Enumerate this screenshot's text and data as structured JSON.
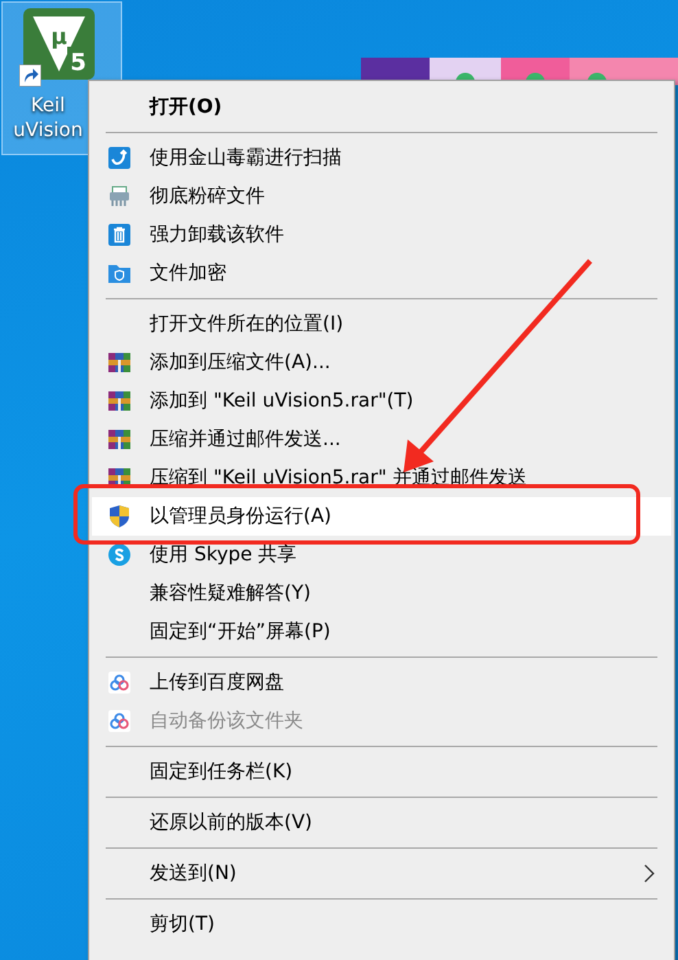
{
  "desktop_icon": {
    "label": "Keil uVision",
    "logo_marks": [
      "μ",
      "5"
    ]
  },
  "context_menu": {
    "items": [
      {
        "kind": "item",
        "label": "打开(O)",
        "default": true,
        "selected": false,
        "disabled": false,
        "submenu": false
      },
      {
        "kind": "separator"
      },
      {
        "kind": "item",
        "label": "使用金山毒霸进行扫描",
        "default": false,
        "selected": false,
        "disabled": false,
        "submenu": false
      },
      {
        "kind": "item",
        "label": "彻底粉碎文件",
        "default": false,
        "selected": false,
        "disabled": false,
        "submenu": false
      },
      {
        "kind": "item",
        "label": "强力卸载该软件",
        "default": false,
        "selected": false,
        "disabled": false,
        "submenu": false
      },
      {
        "kind": "item",
        "label": "文件加密",
        "default": false,
        "selected": false,
        "disabled": false,
        "submenu": false
      },
      {
        "kind": "separator"
      },
      {
        "kind": "item",
        "label": "打开文件所在的位置(I)",
        "default": false,
        "selected": false,
        "disabled": false,
        "submenu": false
      },
      {
        "kind": "item",
        "label": "添加到压缩文件(A)...",
        "default": false,
        "selected": false,
        "disabled": false,
        "submenu": false
      },
      {
        "kind": "item",
        "label": "添加到 \"Keil uVision5.rar\"(T)",
        "default": false,
        "selected": false,
        "disabled": false,
        "submenu": false
      },
      {
        "kind": "item",
        "label": "压缩并通过邮件发送...",
        "default": false,
        "selected": false,
        "disabled": false,
        "submenu": false
      },
      {
        "kind": "item",
        "label": "压缩到 \"Keil uVision5.rar\" 并通过邮件发送",
        "default": false,
        "selected": false,
        "disabled": false,
        "submenu": false
      },
      {
        "kind": "item",
        "label": "以管理员身份运行(A)",
        "default": false,
        "selected": true,
        "disabled": false,
        "submenu": false
      },
      {
        "kind": "item",
        "label": "使用 Skype 共享",
        "default": false,
        "selected": false,
        "disabled": false,
        "submenu": false
      },
      {
        "kind": "item",
        "label": "兼容性疑难解答(Y)",
        "default": false,
        "selected": false,
        "disabled": false,
        "submenu": false
      },
      {
        "kind": "item",
        "label": "固定到“开始”屏幕(P)",
        "default": false,
        "selected": false,
        "disabled": false,
        "submenu": false
      },
      {
        "kind": "separator"
      },
      {
        "kind": "item",
        "label": "上传到百度网盘",
        "default": false,
        "selected": false,
        "disabled": false,
        "submenu": false
      },
      {
        "kind": "item",
        "label": "自动备份该文件夹",
        "default": false,
        "selected": false,
        "disabled": true,
        "submenu": false
      },
      {
        "kind": "separator"
      },
      {
        "kind": "item",
        "label": "固定到任务栏(K)",
        "default": false,
        "selected": false,
        "disabled": false,
        "submenu": false
      },
      {
        "kind": "separator"
      },
      {
        "kind": "item",
        "label": "还原以前的版本(V)",
        "default": false,
        "selected": false,
        "disabled": false,
        "submenu": false
      },
      {
        "kind": "separator"
      },
      {
        "kind": "item",
        "label": "发送到(N)",
        "default": false,
        "selected": false,
        "disabled": false,
        "submenu": true
      },
      {
        "kind": "separator"
      },
      {
        "kind": "item",
        "label": "剪切(T)",
        "default": false,
        "selected": false,
        "disabled": false,
        "submenu": false
      }
    ]
  }
}
